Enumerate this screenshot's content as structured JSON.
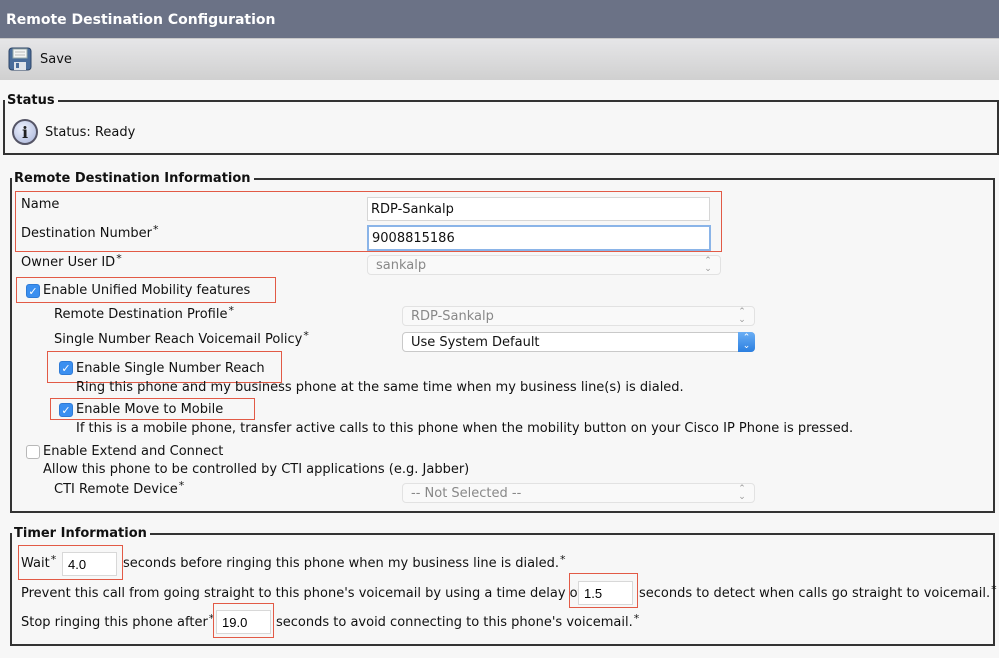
{
  "header": {
    "title": "Remote Destination Configuration"
  },
  "toolbar": {
    "save_label": "Save",
    "save_icon": "floppy-disk-icon"
  },
  "status": {
    "legend": "Status",
    "icon": "info-icon",
    "text": "Status: Ready"
  },
  "rdi": {
    "legend": "Remote Destination Information",
    "name_label": "Name",
    "name_value": "RDP-Sankalp",
    "dest_label": "Destination Number",
    "dest_value": "9008815186",
    "owner_label": "Owner User ID",
    "owner_value": "sankalp",
    "unified_label": "Enable Unified Mobility features",
    "unified_checked": true,
    "profile_label": "Remote Destination Profile",
    "profile_value": "RDP-Sankalp",
    "vm_policy_label": "Single Number Reach Voicemail Policy",
    "vm_policy_value": "Use System Default",
    "snr_label": "Enable Single Number Reach",
    "snr_checked": true,
    "snr_desc": "Ring this phone and my business phone at the same time when my business line(s) is dialed.",
    "mtm_label": "Enable Move to Mobile",
    "mtm_checked": true,
    "mtm_desc": "If this is a mobile phone, transfer active calls to this phone when the mobility button on your Cisco IP Phone is pressed.",
    "ext_label": "Enable Extend and Connect",
    "ext_checked": false,
    "ext_desc": "Allow this phone to be controlled by CTI applications (e.g. Jabber)",
    "cti_label": "CTI Remote Device",
    "cti_value": "-- Not Selected --",
    "required_mark": "*",
    "check_glyph": "✓"
  },
  "timer": {
    "legend": "Timer Information",
    "wait_label": "Wait",
    "wait_value": "4.0",
    "wait_suffix": "seconds before ringing this phone when my business line is dialed.",
    "prevent_label": "Prevent this call from going straight to this phone's voicemail by using a time delay of",
    "prevent_value": "1.5",
    "prevent_suffix": "seconds to detect when calls go straight to voicemail.",
    "stop_label": "Stop ringing this phone after",
    "stop_value": "19.0",
    "stop_suffix": "seconds to avoid connecting to this phone's voicemail."
  }
}
